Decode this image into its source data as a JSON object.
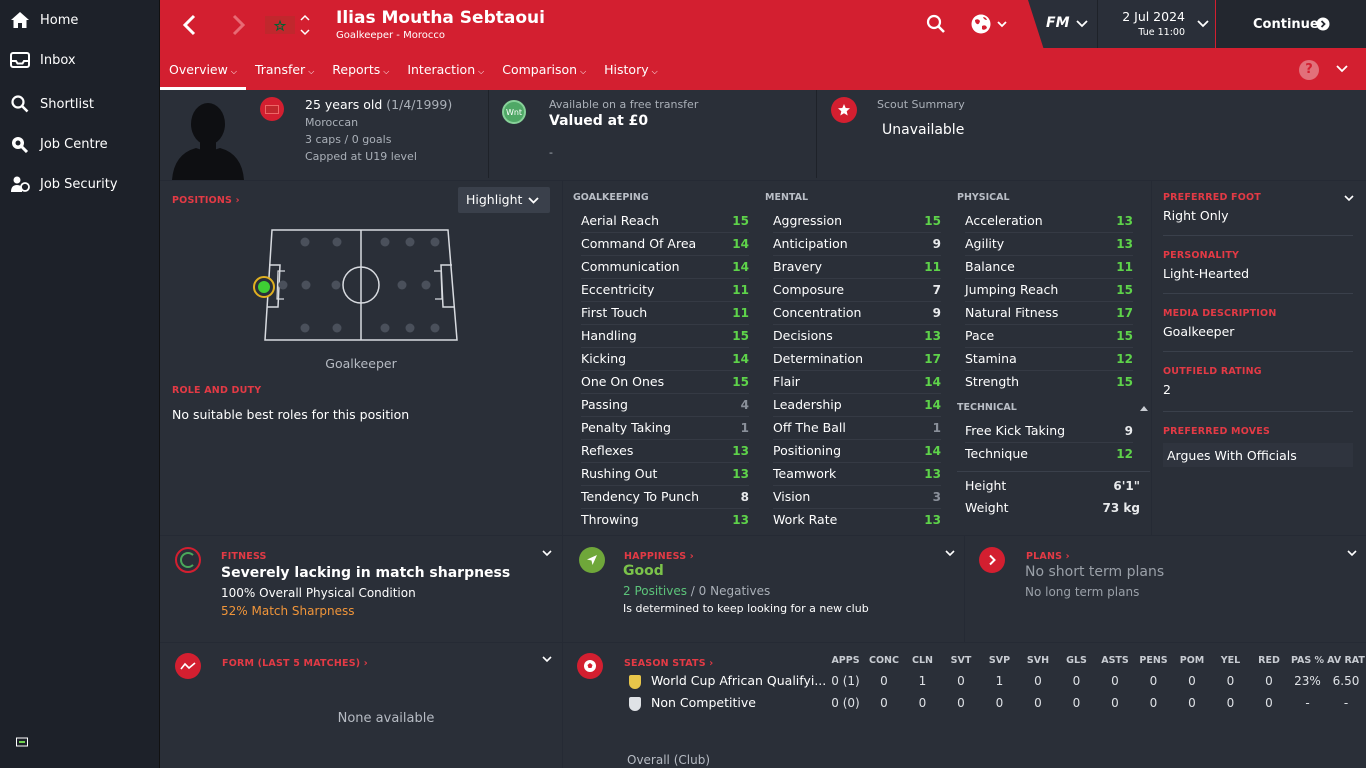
{
  "sidebar": {
    "items": [
      {
        "label": "Home",
        "icon": "home-icon"
      },
      {
        "label": "Inbox",
        "icon": "inbox-icon"
      },
      {
        "label": "Shortlist",
        "icon": "search-icon"
      },
      {
        "label": "Job Centre",
        "icon": "job-centre-icon"
      },
      {
        "label": "Job Security",
        "icon": "job-security-icon"
      }
    ]
  },
  "header": {
    "player_name": "Ilias Moutha Sebtaoui",
    "subtitle": "Goalkeeper - Morocco",
    "date": "2 Jul 2024",
    "day_time": "Tue 11:00",
    "continue_label": "Continue",
    "fm_label": "FM"
  },
  "tabs": [
    "Overview",
    "Transfer",
    "Reports",
    "Interaction",
    "Comparison",
    "History"
  ],
  "info": {
    "age": "25 years old",
    "dob": "(1/4/1999)",
    "nationality": "Moroccan",
    "caps": "3 caps / 0 goals",
    "capped_level": "Capped at U19 level",
    "transfer_badge": "Wnt",
    "transfer_status": "Available on a free transfer",
    "value": "Valued at £0",
    "value_extra": "-",
    "scout_title": "Scout Summary",
    "scout_value": "Unavailable"
  },
  "positions": {
    "header": "POSITIONS",
    "highlight": "Highlight",
    "position_label": "Goalkeeper",
    "role_header": "ROLE AND DUTY",
    "role_text": "No suitable best roles for this position"
  },
  "attributes": {
    "goalkeeping_header": "GOALKEEPING",
    "mental_header": "MENTAL",
    "physical_header": "PHYSICAL",
    "technical_header": "TECHNICAL",
    "goalkeeping": [
      {
        "name": "Aerial Reach",
        "value": "15"
      },
      {
        "name": "Command Of Area",
        "value": "14"
      },
      {
        "name": "Communication",
        "value": "14"
      },
      {
        "name": "Eccentricity",
        "value": "11"
      },
      {
        "name": "First Touch",
        "value": "11"
      },
      {
        "name": "Handling",
        "value": "15"
      },
      {
        "name": "Kicking",
        "value": "14"
      },
      {
        "name": "One On Ones",
        "value": "15"
      },
      {
        "name": "Passing",
        "value": "4"
      },
      {
        "name": "Penalty Taking",
        "value": "1"
      },
      {
        "name": "Reflexes",
        "value": "13"
      },
      {
        "name": "Rushing Out",
        "value": "13"
      },
      {
        "name": "Tendency To Punch",
        "value": "8"
      },
      {
        "name": "Throwing",
        "value": "13"
      }
    ],
    "mental": [
      {
        "name": "Aggression",
        "value": "15"
      },
      {
        "name": "Anticipation",
        "value": "9"
      },
      {
        "name": "Bravery",
        "value": "11"
      },
      {
        "name": "Composure",
        "value": "7"
      },
      {
        "name": "Concentration",
        "value": "9"
      },
      {
        "name": "Decisions",
        "value": "13"
      },
      {
        "name": "Determination",
        "value": "17"
      },
      {
        "name": "Flair",
        "value": "14"
      },
      {
        "name": "Leadership",
        "value": "14"
      },
      {
        "name": "Off The Ball",
        "value": "1"
      },
      {
        "name": "Positioning",
        "value": "14"
      },
      {
        "name": "Teamwork",
        "value": "13"
      },
      {
        "name": "Vision",
        "value": "3"
      },
      {
        "name": "Work Rate",
        "value": "13"
      }
    ],
    "physical": [
      {
        "name": "Acceleration",
        "value": "13"
      },
      {
        "name": "Agility",
        "value": "13"
      },
      {
        "name": "Balance",
        "value": "11"
      },
      {
        "name": "Jumping Reach",
        "value": "15"
      },
      {
        "name": "Natural Fitness",
        "value": "17"
      },
      {
        "name": "Pace",
        "value": "15"
      },
      {
        "name": "Stamina",
        "value": "12"
      },
      {
        "name": "Strength",
        "value": "15"
      }
    ],
    "technical": [
      {
        "name": "Free Kick Taking",
        "value": "9"
      },
      {
        "name": "Technique",
        "value": "12"
      }
    ],
    "height_label": "Height",
    "height": "6'1\"",
    "weight_label": "Weight",
    "weight": "73 kg"
  },
  "profile": {
    "foot_header": "PREFERRED FOOT",
    "foot": "Right Only",
    "personality_header": "PERSONALITY",
    "personality": "Light-Hearted",
    "media_header": "MEDIA DESCRIPTION",
    "media": "Goalkeeper",
    "outfield_header": "OUTFIELD RATING",
    "outfield": "2",
    "moves_header": "PREFERRED MOVES",
    "moves": "Argues With Officials"
  },
  "fitness": {
    "header": "FITNESS",
    "title": "Severely lacking in match sharpness",
    "condition": "100% Overall Physical Condition",
    "sharpness": "52% Match Sharpness"
  },
  "happiness": {
    "header": "HAPPINESS",
    "status": "Good",
    "positives": "2 Positives",
    "separator": "/",
    "negatives": "0 Negatives",
    "note": "Is determined to keep looking for a new club"
  },
  "plans": {
    "header": "PLANS",
    "short": "No short term plans",
    "long": "No long term plans"
  },
  "form": {
    "header": "FORM (LAST 5 MATCHES)",
    "empty": "None available"
  },
  "season_stats": {
    "header": "SEASON STATS",
    "columns": [
      "APPS",
      "CONC",
      "CLN",
      "SVT",
      "SVP",
      "SVH",
      "GLS",
      "ASTS",
      "PENS",
      "POM",
      "YEL",
      "RED",
      "PAS %",
      "AV RAT"
    ],
    "rows": [
      {
        "competition": "World Cup African Qualifyi...",
        "values": [
          "0 (1)",
          "0",
          "1",
          "0",
          "1",
          "0",
          "0",
          "0",
          "0",
          "0",
          "0",
          "0",
          "23%",
          "6.50"
        ]
      },
      {
        "competition": "Non Competitive",
        "values": [
          "0 (0)",
          "0",
          "0",
          "0",
          "0",
          "0",
          "0",
          "0",
          "0",
          "0",
          "0",
          "0",
          "-",
          "-"
        ]
      }
    ],
    "overall_label": "Overall (Club)"
  },
  "colors": {
    "accent": "#d31f30",
    "attr_high": "#5ed34a",
    "panel": "#2a2f38",
    "bg": "#252a34"
  }
}
